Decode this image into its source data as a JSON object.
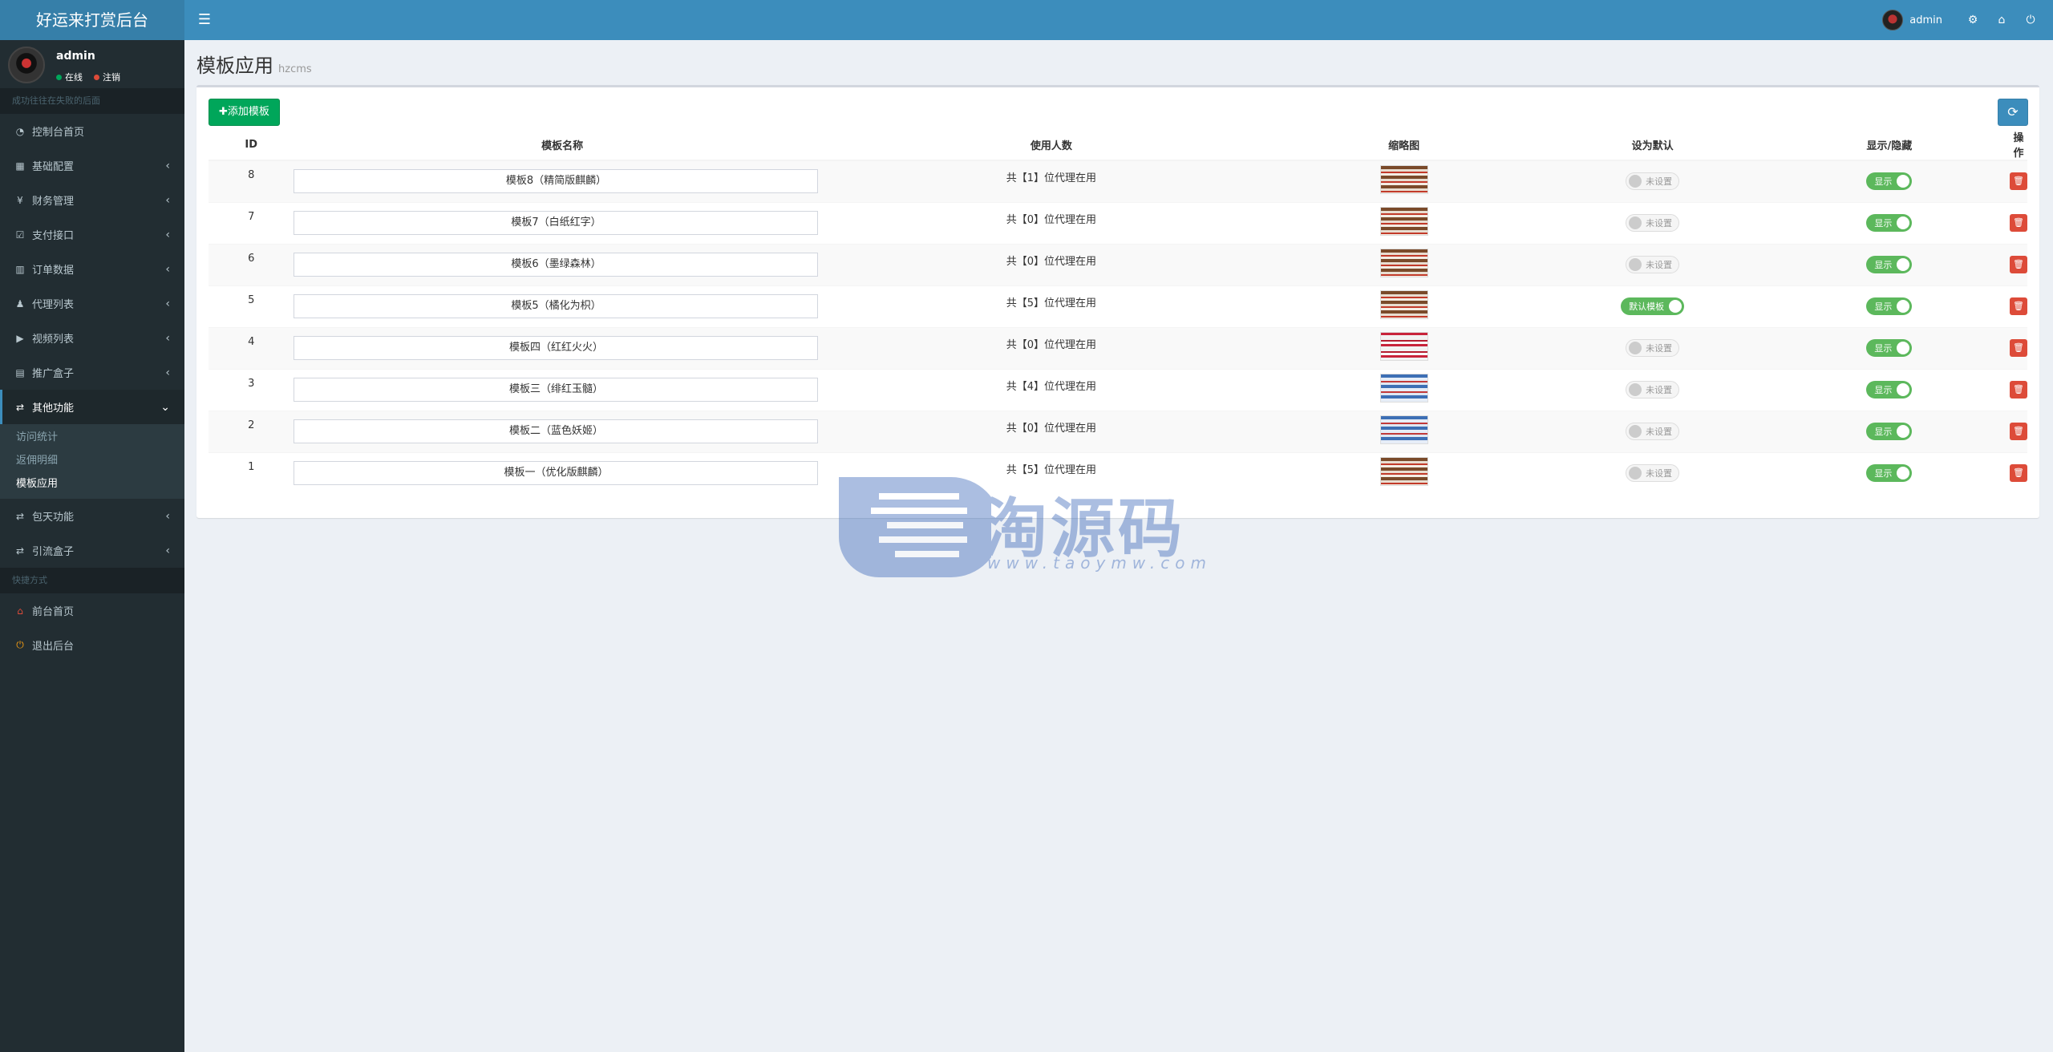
{
  "app": {
    "title": "好运来打赏后台"
  },
  "topbar": {
    "toggle_icon": "bars-icon",
    "username": "admin",
    "icons": [
      "share-nodes-icon",
      "home-icon",
      "power-icon"
    ]
  },
  "sidebar": {
    "user": {
      "name": "admin",
      "status_online": "在线",
      "status_logout": "注销"
    },
    "header_nav": "成功往往在失败的后面",
    "items": [
      {
        "label": "控制台首页",
        "icon": "dashboard-icon",
        "has_children": false
      },
      {
        "label": "基础配置",
        "icon": "th-icon",
        "has_children": true
      },
      {
        "label": "财务管理",
        "icon": "yen-icon",
        "has_children": true
      },
      {
        "label": "支付接口",
        "icon": "check-square-icon",
        "has_children": true
      },
      {
        "label": "订单数据",
        "icon": "bar-chart-icon",
        "has_children": true
      },
      {
        "label": "代理列表",
        "icon": "users-icon",
        "has_children": true
      },
      {
        "label": "视频列表",
        "icon": "video-icon",
        "has_children": true
      },
      {
        "label": "推广盒子",
        "icon": "list-alt-icon",
        "has_children": true
      },
      {
        "label": "其他功能",
        "icon": "retweet-icon",
        "has_children": true,
        "expanded": true,
        "children": [
          {
            "label": "访问统计",
            "active": false
          },
          {
            "label": "返佣明细",
            "active": false
          },
          {
            "label": "模板应用",
            "active": true
          }
        ]
      },
      {
        "label": "包天功能",
        "icon": "retweet-icon",
        "has_children": true
      },
      {
        "label": "引流盒子",
        "icon": "retweet-icon",
        "has_children": true
      }
    ],
    "header_shortcuts": "快捷方式",
    "shortcuts": [
      {
        "label": "前台首页",
        "icon": "home-icon",
        "color": "#dd4b39"
      },
      {
        "label": "退出后台",
        "icon": "power-icon",
        "color": "#f39c12"
      }
    ]
  },
  "content": {
    "title": "模板应用",
    "subtitle": "hzcms",
    "add_button": "✚添加模板",
    "refresh_icon": "refresh-icon",
    "columns": [
      "ID",
      "模板名称",
      "使用人数",
      "缩略图",
      "设为默认",
      "显示/隐藏",
      "操作"
    ],
    "rows": [
      {
        "id": "8",
        "name": "模板8（精简版麒麟）",
        "usage": "共【1】位代理在用",
        "thumb": "thumb-a",
        "is_default": false,
        "default_label": "未设置",
        "shown": true,
        "show_label": "显示"
      },
      {
        "id": "7",
        "name": "模板7（白纸红字）",
        "usage": "共【0】位代理在用",
        "thumb": "thumb-a",
        "is_default": false,
        "default_label": "未设置",
        "shown": true,
        "show_label": "显示"
      },
      {
        "id": "6",
        "name": "模板6（墨绿森林）",
        "usage": "共【0】位代理在用",
        "thumb": "thumb-a",
        "is_default": false,
        "default_label": "未设置",
        "shown": true,
        "show_label": "显示"
      },
      {
        "id": "5",
        "name": "模板5（橘化为枳）",
        "usage": "共【5】位代理在用",
        "thumb": "thumb-a",
        "is_default": true,
        "default_label": "默认模板",
        "shown": true,
        "show_label": "显示"
      },
      {
        "id": "4",
        "name": "模板四（红红火火）",
        "usage": "共【0】位代理在用",
        "thumb": "thumb-b",
        "is_default": false,
        "default_label": "未设置",
        "shown": true,
        "show_label": "显示"
      },
      {
        "id": "3",
        "name": "模板三（绯红玉髓）",
        "usage": "共【4】位代理在用",
        "thumb": "thumb-c",
        "is_default": false,
        "default_label": "未设置",
        "shown": true,
        "show_label": "显示"
      },
      {
        "id": "2",
        "name": "模板二（蓝色妖姬）",
        "usage": "共【0】位代理在用",
        "thumb": "thumb-c",
        "is_default": false,
        "default_label": "未设置",
        "shown": true,
        "show_label": "显示"
      },
      {
        "id": "1",
        "name": "模板一（优化版麒麟）",
        "usage": "共【5】位代理在用",
        "thumb": "thumb-a",
        "is_default": false,
        "default_label": "未设置",
        "shown": true,
        "show_label": "显示"
      }
    ],
    "delete_icon": "trash-icon"
  },
  "watermark": {
    "text": "淘源码",
    "url": "www.taoymw.com"
  },
  "colors": {
    "header": "#3c8dbc",
    "logo": "#367fa9",
    "sidebar": "#222d32",
    "success": "#00a65a",
    "danger": "#dd4b39"
  }
}
